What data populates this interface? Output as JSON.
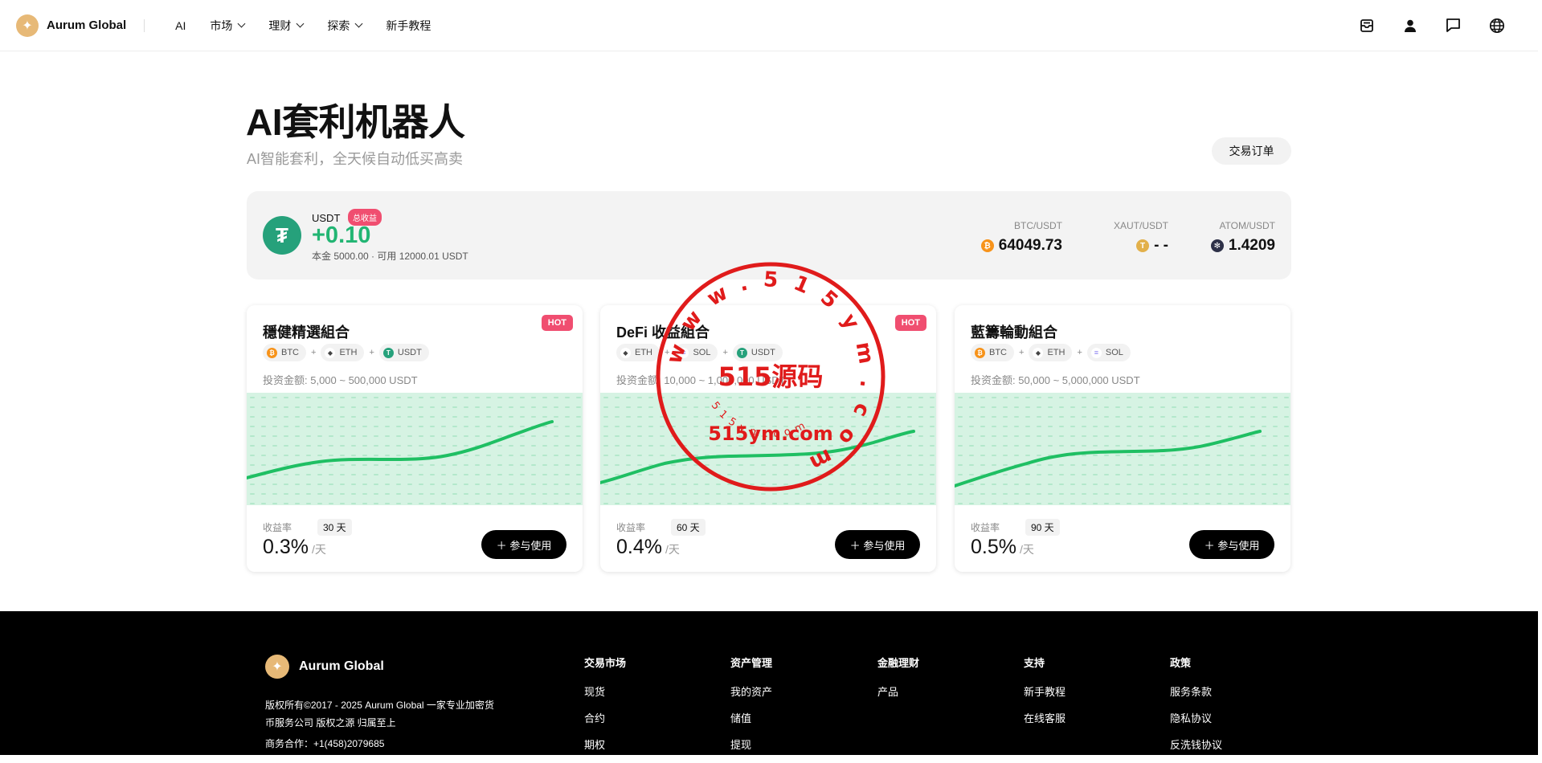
{
  "header": {
    "brand": "Aurum Global",
    "nav": [
      {
        "label": "AI",
        "dropdown": false
      },
      {
        "label": "市场",
        "dropdown": true
      },
      {
        "label": "理财",
        "dropdown": true
      },
      {
        "label": "探索",
        "dropdown": true
      },
      {
        "label": "新手教程",
        "dropdown": false
      }
    ],
    "icons": [
      "inbox-icon",
      "user-icon",
      "chat-icon",
      "globe-icon"
    ]
  },
  "page": {
    "title": "AI套利机器人",
    "subtitle": "AI智能套利，全天候自动低买高卖",
    "orders_button": "交易订单"
  },
  "balance": {
    "currency": "USDT",
    "badge": "总收益",
    "profit": "+0.10",
    "detail": "本金 5000.00 · 可用 12000.01 USDT",
    "tickers": [
      {
        "pair": "BTC/USDT",
        "price": "64049.73",
        "color": "#f7931a",
        "symbol": "₿"
      },
      {
        "pair": "XAUT/USDT",
        "price": "- -",
        "color": "#e2b04a",
        "symbol": "T"
      },
      {
        "pair": "ATOM/USDT",
        "price": "1.4209",
        "color": "#2e3148",
        "symbol": "✻"
      }
    ]
  },
  "cards": [
    {
      "title": "穩健精選組合",
      "badge": "HOT",
      "coins": [
        {
          "name": "BTC",
          "color": "#f7931a",
          "symbol": "₿"
        },
        {
          "name": "ETH",
          "color": "#444",
          "symbol": "◆"
        },
        {
          "name": "USDT",
          "color": "#26a17b",
          "symbol": "T"
        }
      ],
      "range": "投资金额: 5,000 ~ 500,000 USDT",
      "yield_label": "收益率",
      "days": "30 天",
      "rate": "0.3%",
      "unit": "/天",
      "button": "参与使用"
    },
    {
      "title": "DeFi 收益組合",
      "badge": "HOT",
      "coins": [
        {
          "name": "ETH",
          "color": "#444",
          "symbol": "◆"
        },
        {
          "name": "SOL",
          "color": "#8a7ff0",
          "symbol": "≡"
        },
        {
          "name": "USDT",
          "color": "#26a17b",
          "symbol": "T"
        }
      ],
      "range": "投资金额: 10,000 ~ 1,000,000 USDT",
      "yield_label": "收益率",
      "days": "60 天",
      "rate": "0.4%",
      "unit": "/天",
      "button": "参与使用"
    },
    {
      "title": "藍籌輪動組合",
      "badge": "",
      "coins": [
        {
          "name": "BTC",
          "color": "#f7931a",
          "symbol": "₿"
        },
        {
          "name": "ETH",
          "color": "#444",
          "symbol": "◆"
        },
        {
          "name": "SOL",
          "color": "#8a7ff0",
          "symbol": "≡"
        }
      ],
      "range": "投资金额: 50,000 ~ 5,000,000 USDT",
      "yield_label": "收益率",
      "days": "90 天",
      "rate": "0.5%",
      "unit": "/天",
      "button": "参与使用"
    }
  ],
  "footer": {
    "brand": "Aurum Global",
    "copyright": "版权所有©2017 - 2025 Aurum Global 一家专业加密货币服务公司 版权之源 归属至上",
    "business": "商务合作：+1(458)2079685",
    "columns": [
      {
        "title": "交易市场",
        "items": [
          "现货",
          "合约",
          "期权"
        ]
      },
      {
        "title": "资产管理",
        "items": [
          "我的资产",
          "储值",
          "提现"
        ]
      },
      {
        "title": "金融理财",
        "items": [
          "产品"
        ]
      },
      {
        "title": "支持",
        "items": [
          "新手教程",
          "在线客服"
        ]
      },
      {
        "title": "政策",
        "items": [
          "服务条款",
          "隐私协议",
          "反洗钱协议"
        ]
      }
    ]
  },
  "watermark": {
    "main": "515源码",
    "url": "515ym.com",
    "ring": "www.515ym.com",
    "small": "515ym.com"
  },
  "colors": {
    "accent_green": "#22b573",
    "hot": "#f04e70",
    "brand_gold": "#e7b977"
  }
}
